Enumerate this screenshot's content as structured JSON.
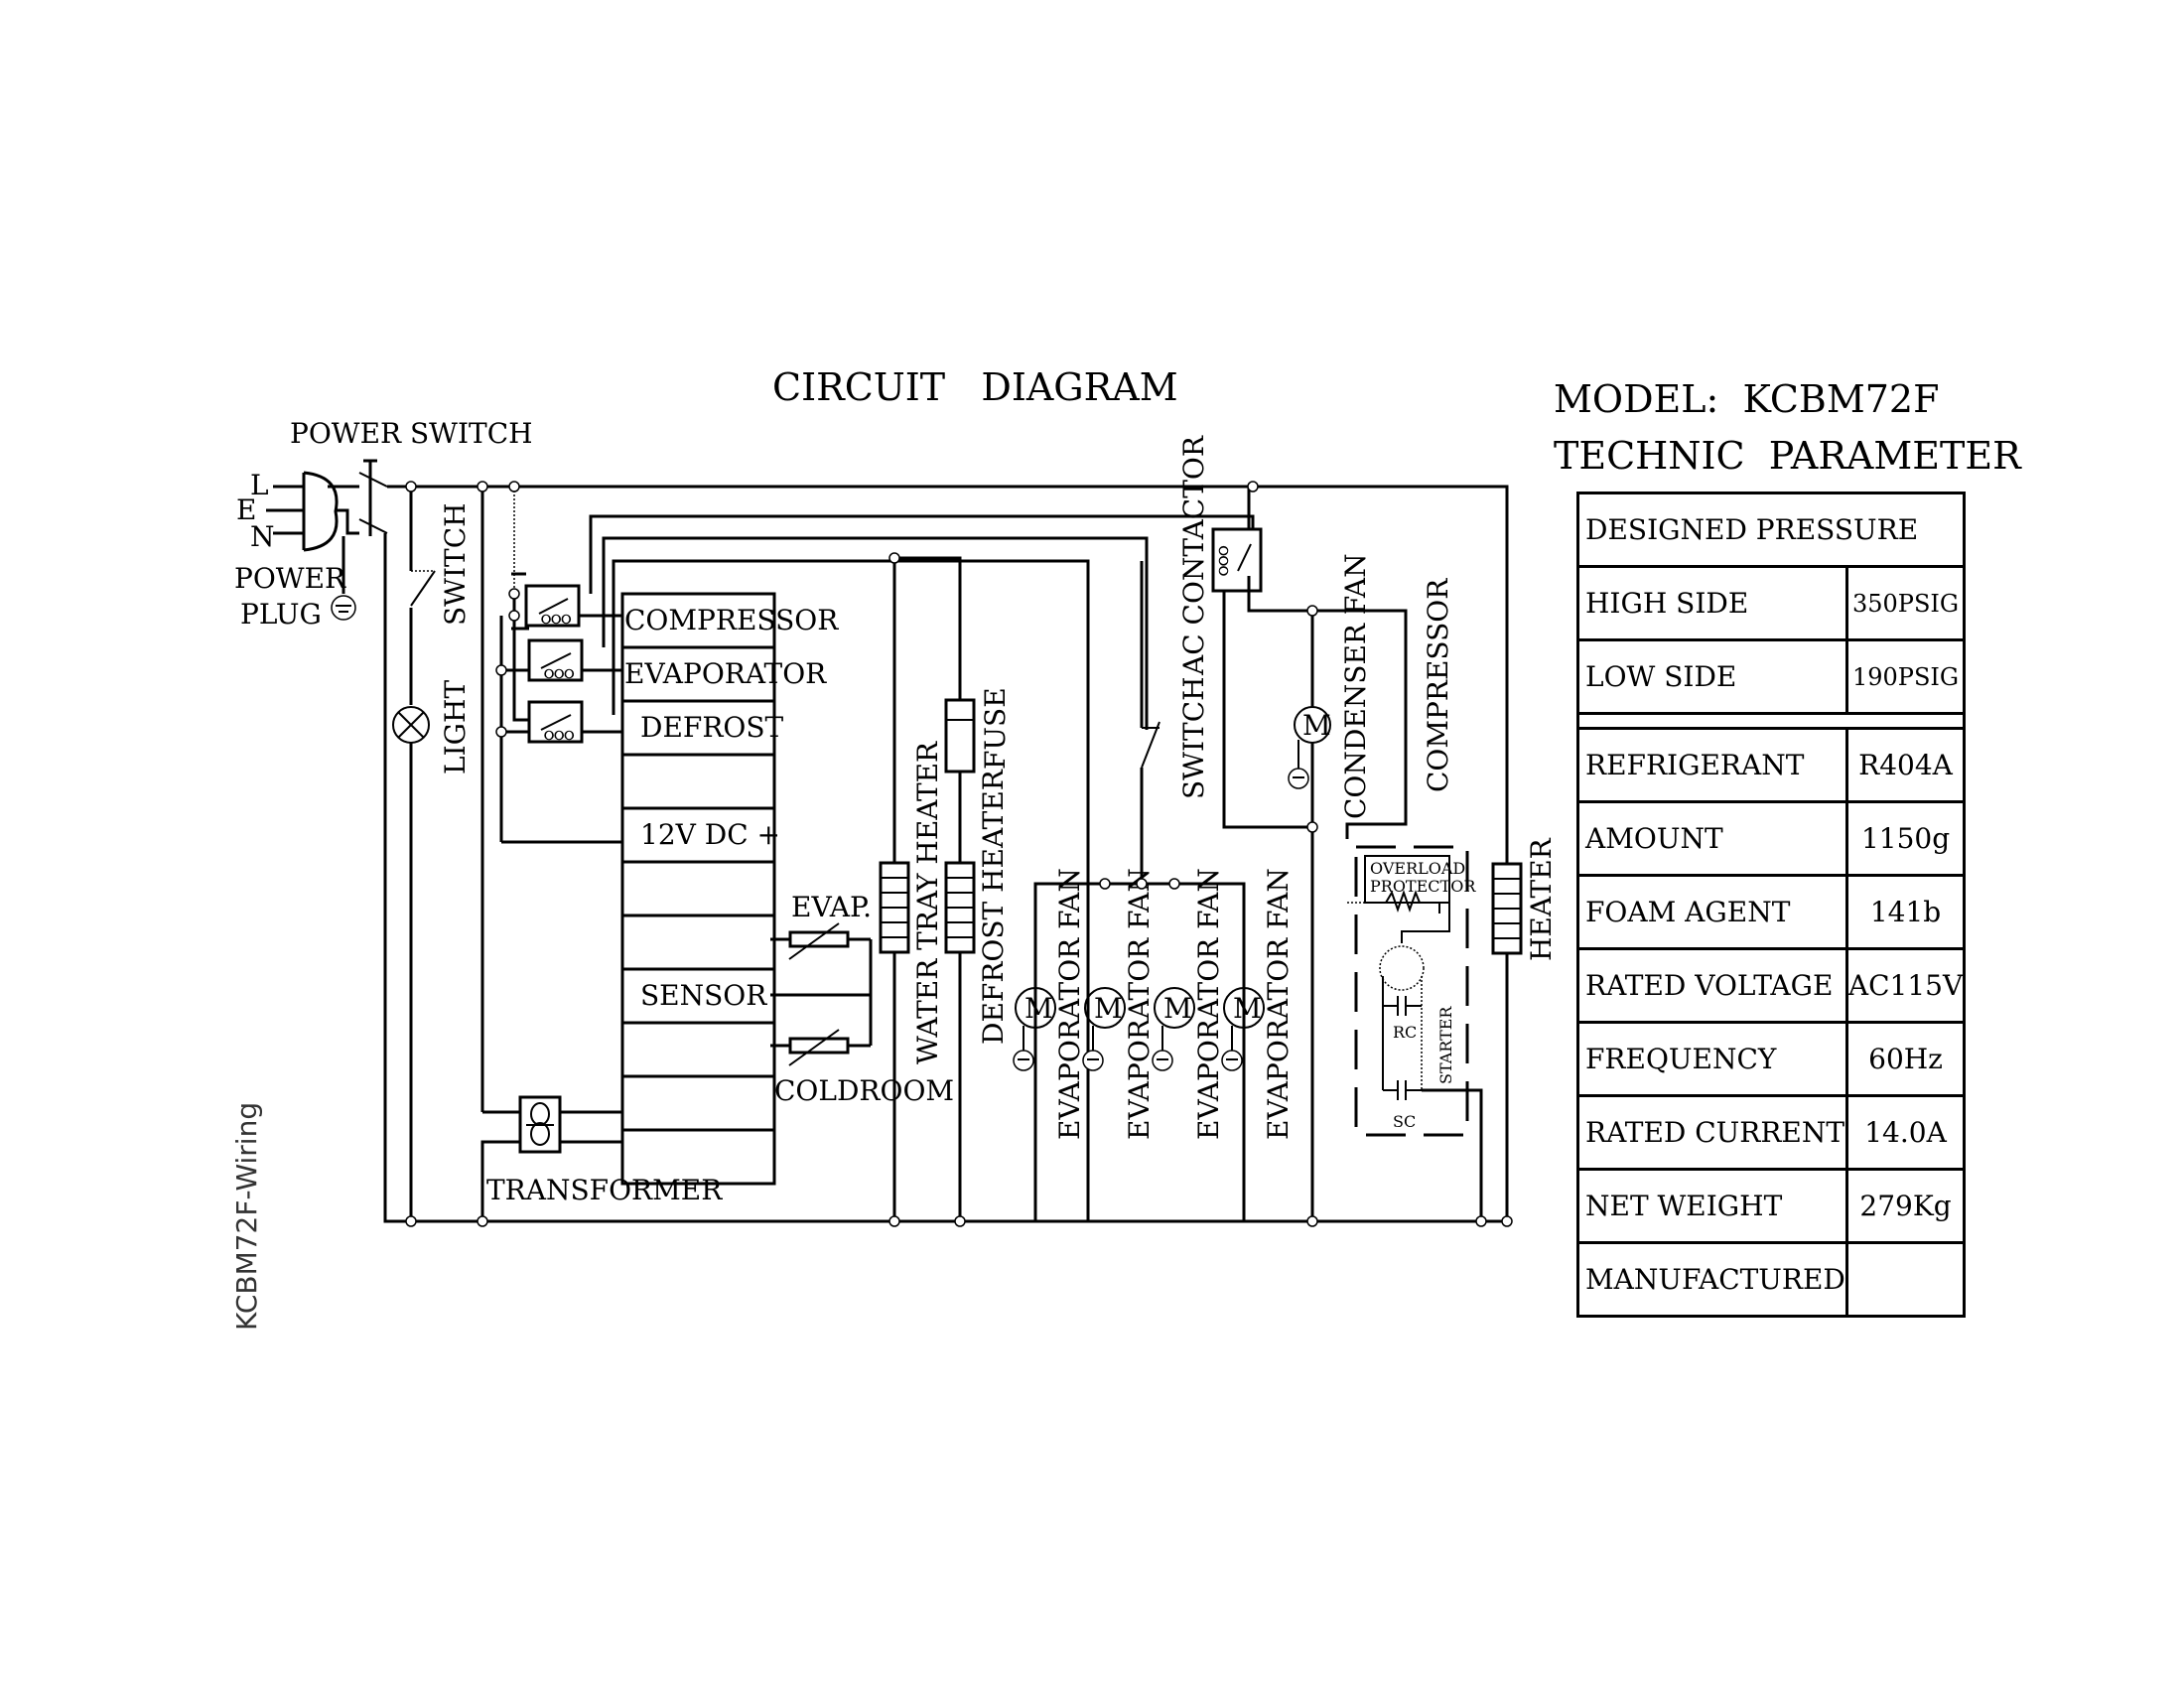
{
  "diagram": {
    "title": "CIRCUIT   DIAGRAM",
    "side_label": "KCBM72F-Wiring",
    "power": {
      "switch_label": "POWER SWITCH",
      "plug_label_line1": "POWER",
      "plug_label_line2": "PLUG",
      "pins": [
        "L",
        "E",
        "N"
      ]
    },
    "components": {
      "door_switch": "SWITCH",
      "light": "LIGHT",
      "transformer": "TRANSFORMER",
      "fuse": "FUSE",
      "water_tray_heater": "WATER TRAY HEATER",
      "defrost_heater": "DEFROST HEATER",
      "fan_switch": "SWITCH",
      "ac_contactor": "AC CONTACTOR",
      "condenser_fan": "CONDENSER FAN",
      "compressor": "COMPRESSOR",
      "heater": "HEATER",
      "overload_line1": "OVERLOAD",
      "overload_line2": "PROTECTOR",
      "rc": "RC",
      "sc": "SC",
      "starter": "STARTER",
      "motor_symbol": "M",
      "evap_sensor": "EVAP.",
      "coldroom_sensor": "COLDROOM",
      "evaporator_fans": [
        "EVAPORATOR FAN",
        "EVAPORATOR FAN",
        "EVAPORATOR FAN",
        "EVAPORATOR FAN"
      ]
    },
    "controller_terminals": [
      "COMPRESSOR",
      "EVAPORATOR",
      "DEFROST",
      "",
      "12V DC +",
      "",
      "",
      "SENSOR",
      "",
      "",
      ""
    ]
  },
  "parameters": {
    "model_label": "MODEL:  KCBM72F",
    "title": "TECHNIC  PARAMETER",
    "designed_pressure_header": "DESIGNED PRESSURE",
    "pressure_rows": [
      {
        "label": "HIGH SIDE",
        "value": "350PSIG"
      },
      {
        "label": "LOW SIDE",
        "value": "190PSIG"
      }
    ],
    "rows": [
      {
        "label": "REFRIGERANT",
        "value": "R404A"
      },
      {
        "label": "AMOUNT",
        "value": "1150g"
      },
      {
        "label": "FOAM AGENT",
        "value": "141b"
      },
      {
        "label": "RATED VOLTAGE",
        "value": "AC115V"
      },
      {
        "label": "FREQUENCY",
        "value": "60Hz"
      },
      {
        "label": "RATED CURRENT",
        "value": "14.0A"
      },
      {
        "label": "NET WEIGHT",
        "value": "279Kg"
      },
      {
        "label": "MANUFACTURED",
        "value": ""
      }
    ]
  }
}
